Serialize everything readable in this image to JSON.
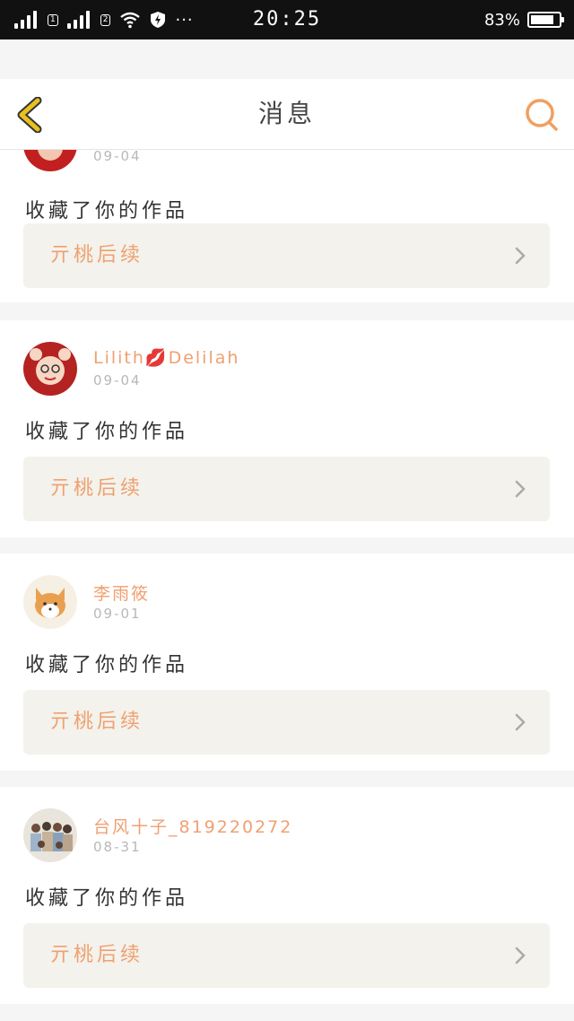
{
  "status_bar": {
    "time": "20:25",
    "battery": "83%",
    "battery_level": 0.83,
    "sim1": "1",
    "sim2": "2",
    "more": "···"
  },
  "header": {
    "title": "消息",
    "back_icon": "chevron-left-icon",
    "search_icon": "search-icon"
  },
  "colors": {
    "accent": "#f0a070",
    "back_icon": "#e8c020",
    "search_icon": "#f0a060",
    "work_box_bg": "#f3f2ec"
  },
  "notifications": [
    {
      "username": "",
      "date": "09-04",
      "action": "收藏了你的作品",
      "work_title": "亓桃后续"
    },
    {
      "username": "Lilith💋Delilah",
      "date": "09-04",
      "action": "收藏了你的作品",
      "work_title": "亓桃后续"
    },
    {
      "username": "李雨筱",
      "date": "09-01",
      "action": "收藏了你的作品",
      "work_title": "亓桃后续"
    },
    {
      "username": "台风十子_819220272",
      "date": "08-31",
      "action": "收藏了你的作品",
      "work_title": "亓桃后续"
    }
  ]
}
